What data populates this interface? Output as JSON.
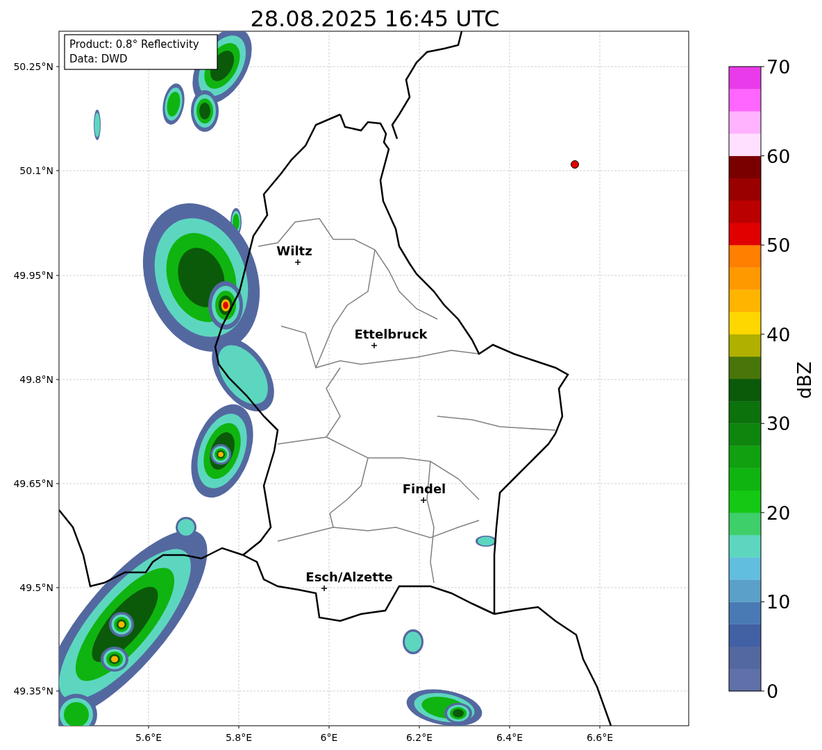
{
  "title": "28.08.2025 16:45 UTC",
  "info_box": {
    "lines": [
      "Product: 0.8° Reflectivity",
      "Data: DWD"
    ]
  },
  "map": {
    "lat_ticks": [
      "50.25°N",
      "50.1°N",
      "49.95°N",
      "49.8°N",
      "49.65°N",
      "49.5°N",
      "49.35°N"
    ],
    "lon_ticks": [
      "5.6°E",
      "5.8°E",
      "6°E",
      "6.2°E",
      "6.4°E",
      "6.6°E"
    ],
    "places": [
      {
        "name": "Wiltz"
      },
      {
        "name": "Ettelbruck"
      },
      {
        "name": "Findel"
      },
      {
        "name": "Esch/Alzette"
      }
    ]
  },
  "colorbar": {
    "label": "dBZ",
    "ticks": [
      "70",
      "60",
      "50",
      "40",
      "30",
      "20",
      "10",
      "0"
    ],
    "bins": [
      {
        "color": "#6070a8"
      },
      {
        "color": "#5468a0"
      },
      {
        "color": "#4260a4"
      },
      {
        "color": "#4a7ab4"
      },
      {
        "color": "#5aa0c8"
      },
      {
        "color": "#62bede"
      },
      {
        "color": "#5dd6c0"
      },
      {
        "color": "#3ecf6a"
      },
      {
        "color": "#14c814"
      },
      {
        "color": "#10b410"
      },
      {
        "color": "#10a010"
      },
      {
        "color": "#0e860e"
      },
      {
        "color": "#0c720c"
      },
      {
        "color": "#0a5a0a"
      },
      {
        "color": "#48760a"
      },
      {
        "color": "#b0b000"
      },
      {
        "color": "#ffd700"
      },
      {
        "color": "#ffb400"
      },
      {
        "color": "#ff9900"
      },
      {
        "color": "#ff7f00"
      },
      {
        "color": "#e00000"
      },
      {
        "color": "#bb0000"
      },
      {
        "color": "#9a0000"
      },
      {
        "color": "#7a0000"
      },
      {
        "color": "#ffe0ff"
      },
      {
        "color": "#ffb3ff"
      },
      {
        "color": "#ff66ff"
      },
      {
        "color": "#e93be9"
      }
    ]
  }
}
